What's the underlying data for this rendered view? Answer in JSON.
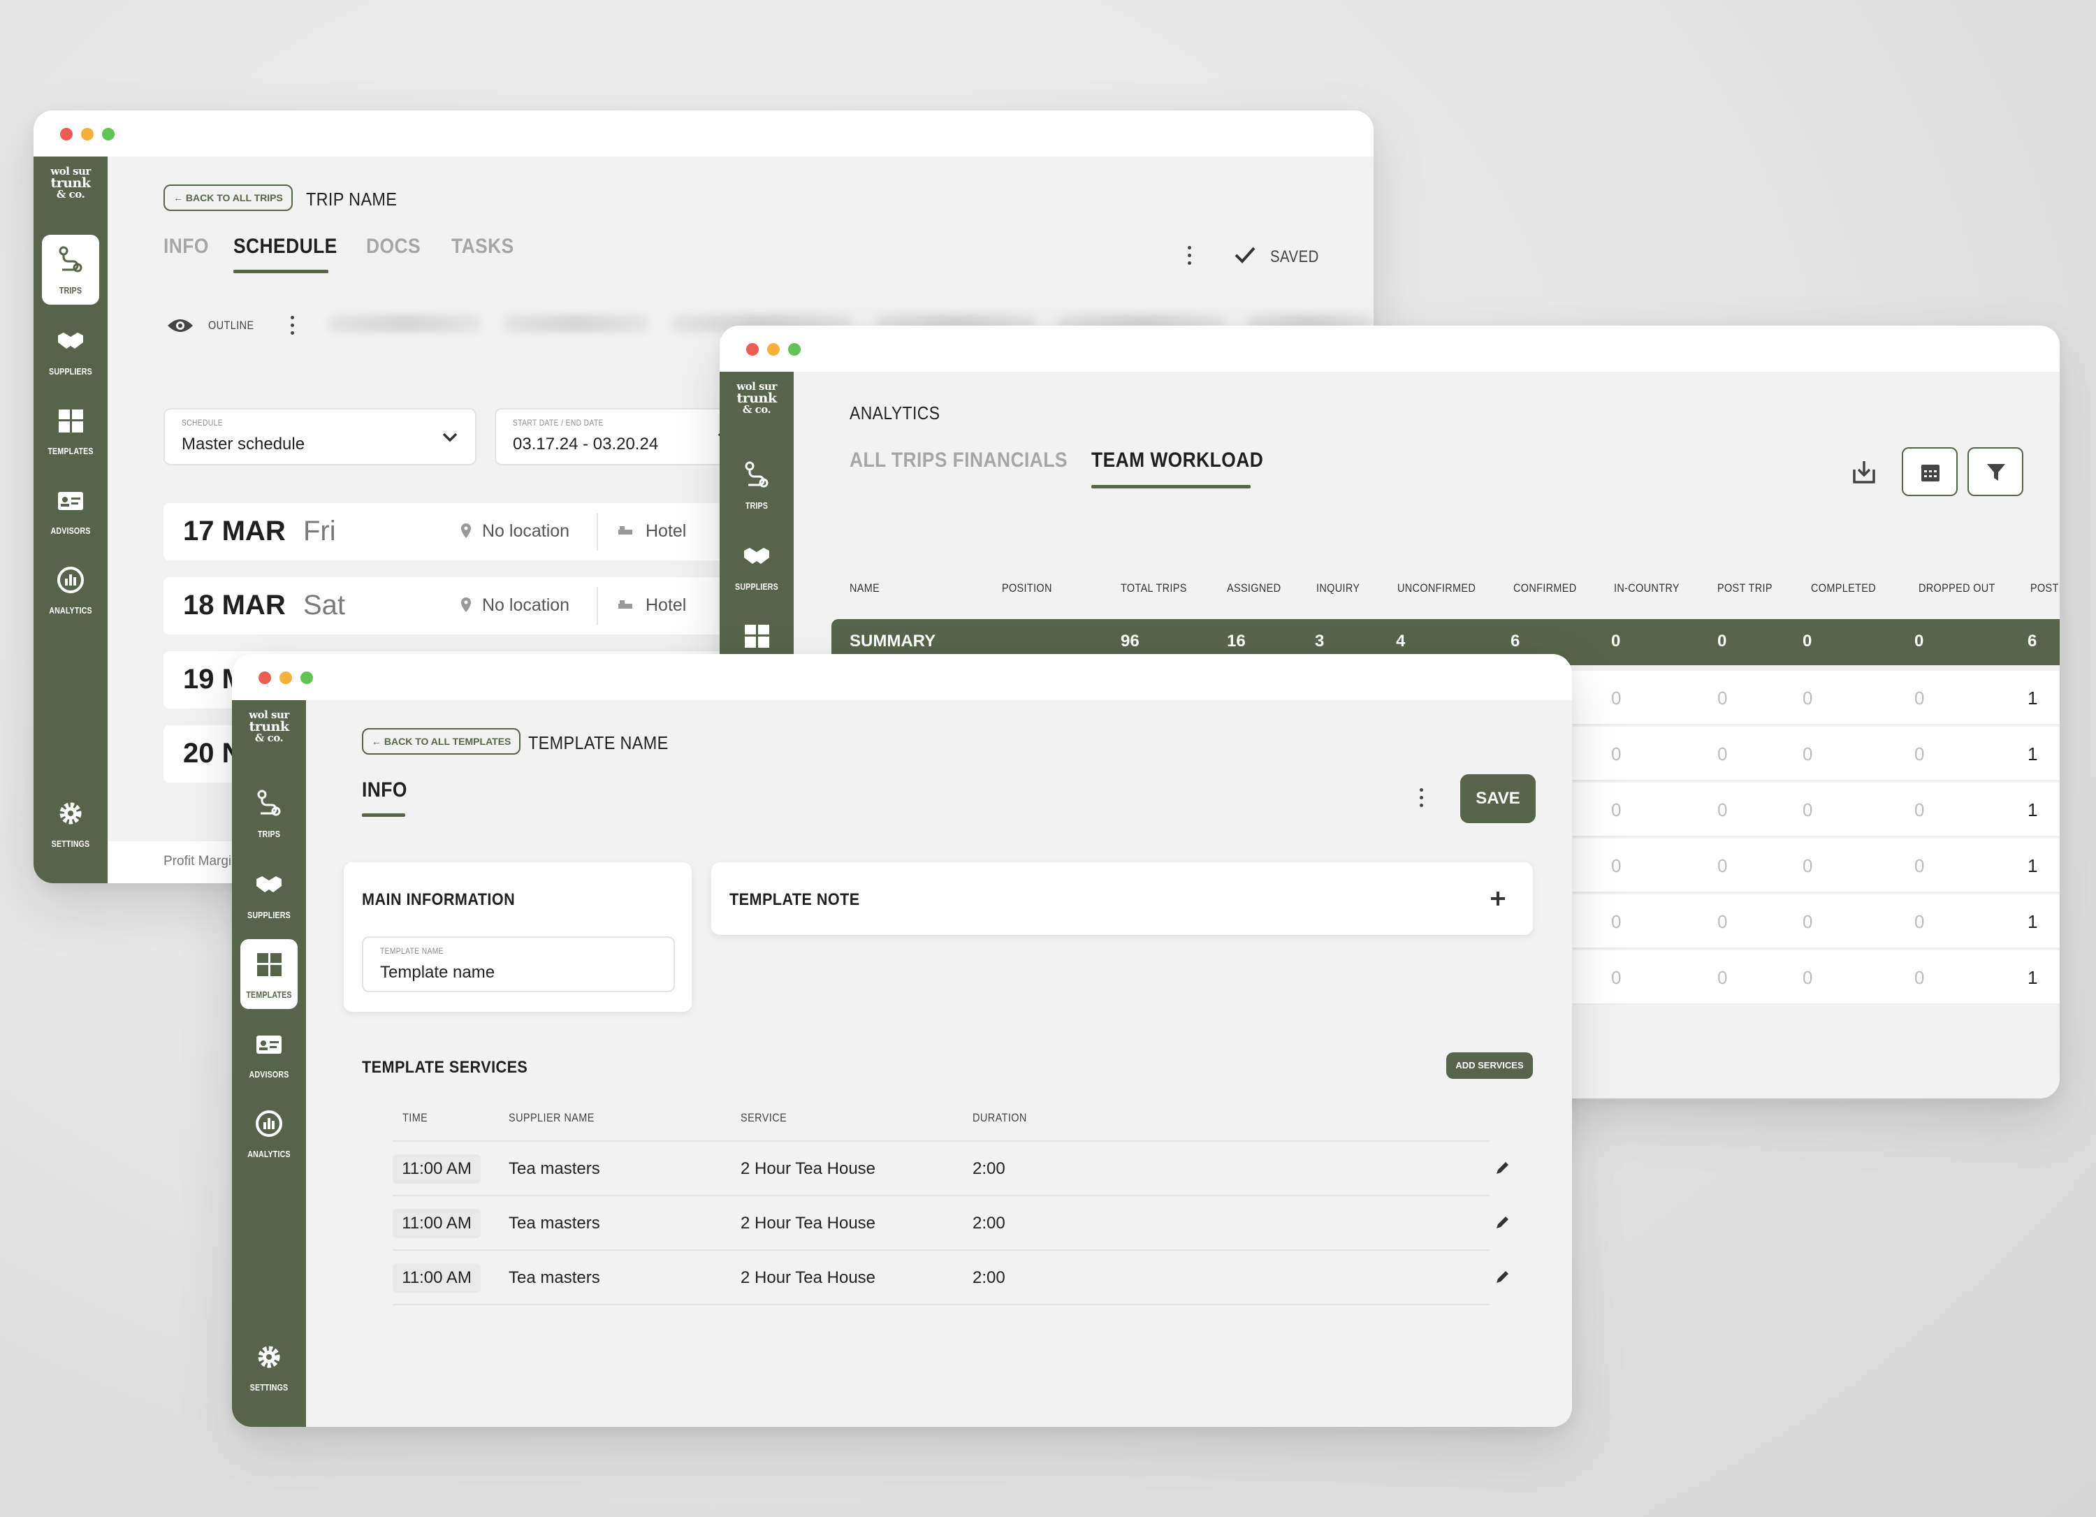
{
  "nav": {
    "logo_line1": "wol sur",
    "logo_line2": "trunk",
    "logo_line3": "& co.",
    "trips": "TRIPS",
    "suppliers": "SUPPLIERS",
    "templates": "TEMPLATES",
    "advisors": "ADVISORS",
    "analytics": "ANALYTICS",
    "settings": "SETTINGS"
  },
  "trip": {
    "back_label": "← BACK TO ALL TRIPS",
    "name": "TRIP NAME",
    "tabs": [
      "INFO",
      "SCHEDULE",
      "DOCS",
      "TASKS"
    ],
    "saved_label": "SAVED",
    "outline_label": "OUTLINE",
    "schedule_field_label": "SCHEDULE",
    "schedule_value": "Master schedule",
    "date_field_label": "START DATE / END DATE",
    "date_value": "03.17.24 - 03.20.24",
    "days": [
      {
        "date": "17 MAR",
        "dow": "Fri",
        "location": "No location",
        "hotel": "Hotel"
      },
      {
        "date": "18 MAR",
        "dow": "Sat",
        "location": "No location",
        "hotel": "Hotel"
      },
      {
        "date": "19 M",
        "dow": "",
        "location": "",
        "hotel": ""
      },
      {
        "date": "20 N",
        "dow": "",
        "location": "",
        "hotel": ""
      }
    ],
    "footer_text": "Profit Margi"
  },
  "analytics": {
    "title": "ANALYTICS",
    "tabs": [
      "ALL TRIPS FINANCIALS",
      "TEAM WORKLOAD"
    ],
    "columns": [
      "NAME",
      "POSITION",
      "TOTAL TRIPS",
      "ASSIGNED",
      "INQUIRY",
      "UNCONFIRMED",
      "CONFIRMED",
      "IN-COUNTRY",
      "POST TRIP",
      "COMPLETED",
      "DROPPED OUT",
      "POSTE"
    ],
    "summary": {
      "label": "SUMMARY",
      "total_trips": "96",
      "assigned": "16",
      "inquiry": "3",
      "unconfirmed": "4",
      "confirmed": "6",
      "in_country": "0",
      "post_trip": "0",
      "completed": "0",
      "dropped_out": "0",
      "poste": "6"
    },
    "rows": [
      [
        "0",
        "0",
        "0",
        "0",
        "1"
      ],
      [
        "0",
        "0",
        "0",
        "0",
        "1"
      ],
      [
        "0",
        "0",
        "0",
        "0",
        "1"
      ],
      [
        "0",
        "0",
        "0",
        "0",
        "1"
      ],
      [
        "0",
        "0",
        "0",
        "0",
        "1"
      ],
      [
        "0",
        "0",
        "0",
        "0",
        "1"
      ]
    ]
  },
  "template": {
    "back_label": "← BACK TO ALL TEMPLATES",
    "name": "TEMPLATE NAME",
    "tab": "INFO",
    "save_label": "SAVE",
    "main_info_title": "MAIN INFORMATION",
    "name_field_label": "TEMPLATE NAME",
    "name_field_value": "Template name",
    "note_title": "TEMPLATE NOTE",
    "services_title": "TEMPLATE SERVICES",
    "add_services_label": "ADD SERVICES",
    "service_columns": [
      "TIME",
      "SUPPLIER NAME",
      "SERVICE",
      "DURATION"
    ],
    "services": [
      {
        "time": "11:00 AM",
        "supplier": "Tea masters",
        "service": "2 Hour Tea House",
        "duration": "2:00"
      },
      {
        "time": "11:00 AM",
        "supplier": "Tea masters",
        "service": "2 Hour Tea House",
        "duration": "2:00"
      },
      {
        "time": "11:00 AM",
        "supplier": "Tea masters",
        "service": "2 Hour Tea House",
        "duration": "2:00"
      }
    ]
  },
  "colors": {
    "brand_green": "#56654a",
    "background": "#f2f2f2"
  }
}
